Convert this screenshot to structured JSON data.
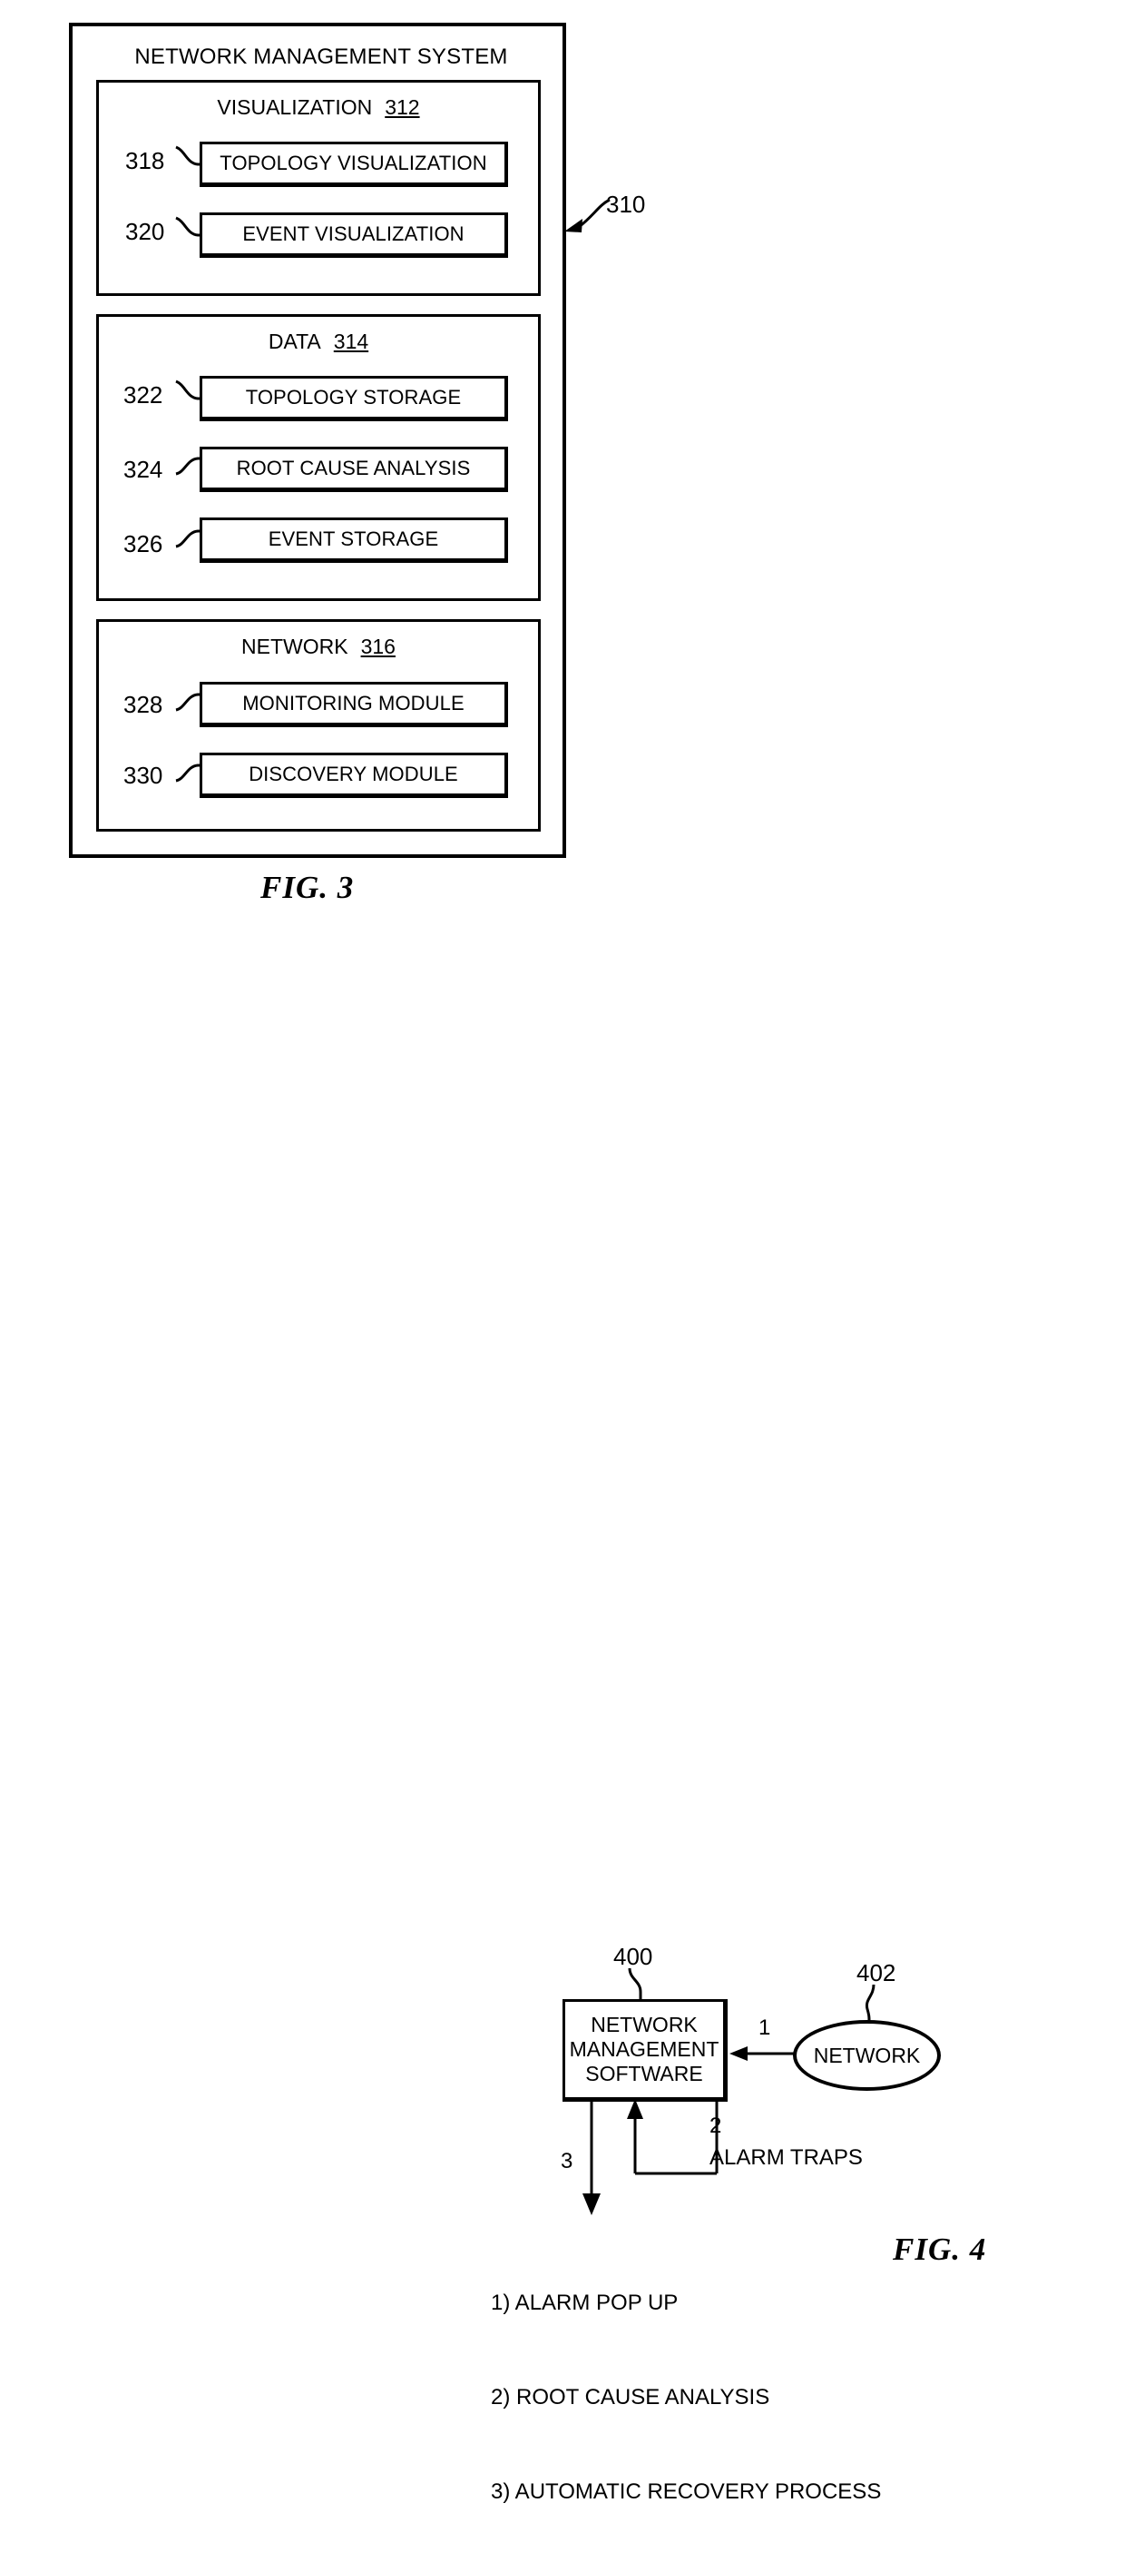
{
  "figure3": {
    "label": "FIG. 3",
    "system_title": "NETWORK MANAGEMENT SYSTEM",
    "system_ref": "310",
    "groups": [
      {
        "title": "VISUALIZATION",
        "ref": "312",
        "items": [
          {
            "ref": "318",
            "label": "TOPOLOGY VISUALIZATION"
          },
          {
            "ref": "320",
            "label": "EVENT VISUALIZATION"
          }
        ]
      },
      {
        "title": "DATA",
        "ref": "314",
        "items": [
          {
            "ref": "322",
            "label": "TOPOLOGY STORAGE"
          },
          {
            "ref": "324",
            "label": "ROOT CAUSE ANALYSIS"
          },
          {
            "ref": "326",
            "label": "EVENT STORAGE"
          }
        ]
      },
      {
        "title": "NETWORK",
        "ref": "316",
        "items": [
          {
            "ref": "328",
            "label": "MONITORING MODULE"
          },
          {
            "ref": "330",
            "label": "DISCOVERY MODULE"
          }
        ]
      }
    ]
  },
  "figure4": {
    "label": "FIG. 4",
    "software_box": {
      "ref": "400",
      "line1": "NETWORK",
      "line2": "MANAGEMENT",
      "line3": "SOFTWARE"
    },
    "network_node": {
      "ref": "402",
      "label": "NETWORK"
    },
    "flows": {
      "flow1": "1",
      "flow2": "2",
      "flow3": "3",
      "alarm_traps_label": "ALARM TRAPS"
    },
    "legend": [
      "1) ALARM POP UP",
      "2) ROOT CAUSE ANALYSIS",
      "3) AUTOMATIC RECOVERY PROCESS"
    ]
  },
  "colors": {
    "ink": "#000000",
    "paper": "#ffffff"
  }
}
